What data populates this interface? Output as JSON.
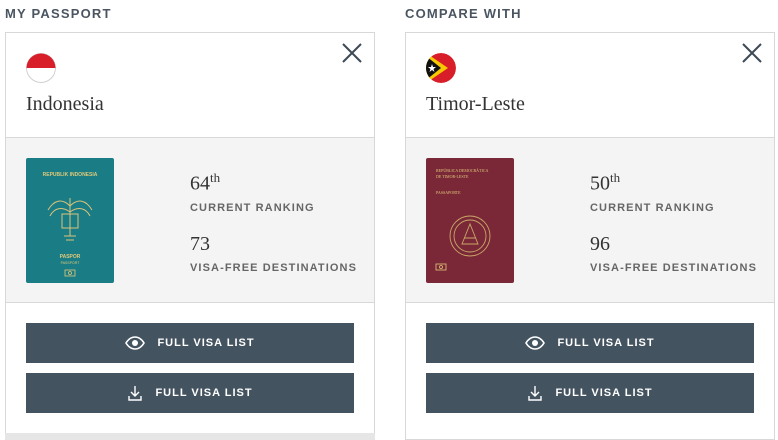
{
  "left": {
    "heading": "MY PASSPORT",
    "country": "Indonesia",
    "flag_colors": [
      "#d81e28",
      "#ffffff"
    ],
    "passport_color": "#1a7d86",
    "passport_title": "REPUBLIK INDONESIA",
    "passport_sub": "PASPOR",
    "passport_sub2": "PASSPORT",
    "rank_num": "64",
    "rank_suffix": "th",
    "rank_label": "CURRENT RANKING",
    "visa_free": "73",
    "visa_label": "VISA-FREE DESTINATIONS",
    "btn_view": "FULL VISA LIST",
    "btn_download": "FULL VISA LIST"
  },
  "right": {
    "heading": "COMPARE WITH",
    "country": "Timor-Leste",
    "flag_colors": [
      "#d81e28",
      "#f7c900",
      "#111111",
      "#ffffff"
    ],
    "passport_color": "#7a2838",
    "passport_title": "REPÚBLICA DEMOCRÁTICA DE TIMOR-LESTE",
    "passport_sub": "PASSAPORTE",
    "rank_num": "50",
    "rank_suffix": "th",
    "rank_label": "CURRENT RANKING",
    "visa_free": "96",
    "visa_label": "VISA-FREE DESTINATIONS",
    "btn_view": "FULL VISA LIST",
    "btn_download": "FULL VISA LIST"
  },
  "icons": {
    "close": "close-icon",
    "view": "eye-icon",
    "download": "download-icon"
  }
}
